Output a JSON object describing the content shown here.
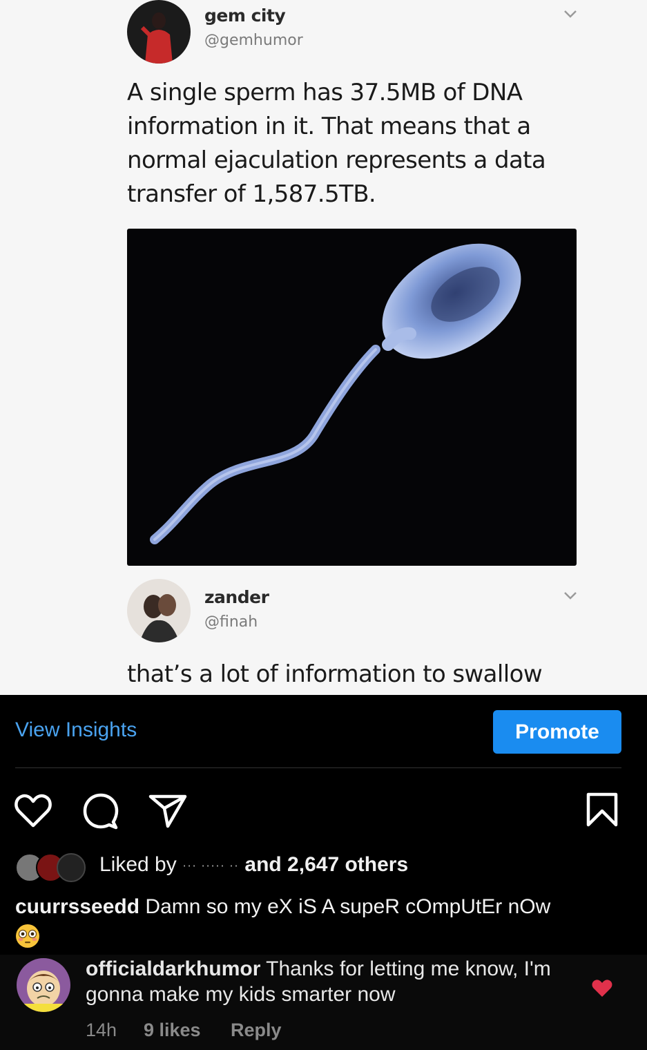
{
  "post": {
    "tweet1": {
      "name": "gem city",
      "handle": "@gemhumor",
      "text_lines": [
        "A single sperm has 37.5MB of DNA",
        "information in it. That means that a",
        "normal ejaculation represents a data",
        "transfer of 1,587.5TB."
      ]
    },
    "tweet2": {
      "name": "zander",
      "handle": "@finah",
      "text": "that’s a lot of information to swallow"
    }
  },
  "actions": {
    "view_insights": "View Insights",
    "promote": "Promote"
  },
  "likes": {
    "prefix": "Liked by",
    "hidden_names": "··· ····· ··",
    "suffix": "and 2,647 others"
  },
  "caption": {
    "username": "cuurrsseedd",
    "text": "Damn so my eX iS A supeR cOmpUtEr nOw",
    "emoji": "flushed-face-emoji"
  },
  "comment": {
    "username": "officialdarkhumor",
    "text": "Thanks for letting me know, I'm gonna make my kids smarter now",
    "time": "14h",
    "likes": "9 likes",
    "reply": "Reply",
    "liked": true
  },
  "colors": {
    "link_blue": "#4aa3f0",
    "promote_blue": "#1a8cf0",
    "heart_red": "#e0314b"
  }
}
